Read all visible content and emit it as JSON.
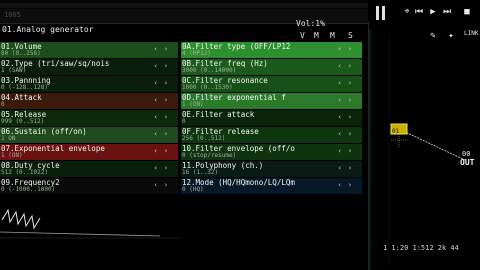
{
  "topbar": {
    "label_left": "1065",
    "volume": "Vol:1%"
  },
  "toolbar": {
    "icons": [
      "pause-bars-icon",
      "pin-icon",
      "skip-back-icon",
      "play-icon",
      "play-next-icon",
      "stop-icon",
      "wrench-icon",
      "wand-icon",
      "link-icon"
    ],
    "link_label": "LINK"
  },
  "panel": {
    "title": "01.Analog generator",
    "buttons": [
      "V",
      "M",
      "M",
      "S"
    ],
    "left": [
      {
        "name": "01.Volume",
        "value": "80 (0..256)",
        "color": "#1a4d1a"
      },
      {
        "name": "02.Type (tri/saw/sq/nois",
        "value": "1 (SAW)",
        "color": "#0a1f0a"
      },
      {
        "name": "03.Pannning",
        "value": "0 (-128..128)",
        "color": "#0a1f0a"
      },
      {
        "name": "04.Attack",
        "value": "0",
        "color": "#3a1a0a"
      },
      {
        "name": "05.Release",
        "value": "999 (0..512)",
        "color": "#0a2a0a"
      },
      {
        "name": "06.Sustain (off/on)",
        "value": "1 ON",
        "color": "#1e4a1e"
      },
      {
        "name": "07.Exponential envelope",
        "value": "1 (ON)",
        "color": "#6a1212"
      },
      {
        "name": "08.Duty cycle",
        "value": "512 (0..1022)",
        "color": "#0a1f0a"
      },
      {
        "name": "09.Frequency2",
        "value": "0 (-1000..1000)",
        "color": "#0a0a0a"
      }
    ],
    "right": [
      {
        "name": "0A.Filter type (OFF/LP12",
        "value": "4 (HP12)",
        "color": "#2e8f2e"
      },
      {
        "name": "0B.Filter freq (Hz)",
        "value": "3000 (0..14000)",
        "color": "#1a5a1a"
      },
      {
        "name": "0C.Filter resonance",
        "value": "1000 (0..1530)",
        "color": "#165016"
      },
      {
        "name": "0D.Filter exponential f",
        "value": "1 (ON)",
        "color": "#2a7a2a"
      },
      {
        "name": "0E.Filter attack",
        "value": "0",
        "color": "#0a240a"
      },
      {
        "name": "0F.Filter release",
        "value": "256 (0..512)",
        "color": "#0e360e"
      },
      {
        "name": "10.Filter envelope (off/o",
        "value": "0 (stop/resume)",
        "color": "#0e330e"
      },
      {
        "name": "11.Polyphony (ch.)",
        "value": "16 (1..32)",
        "color": "#0a1a14"
      },
      {
        "name": "12.Mode (HQ/HQmono/LQ/LQm",
        "value": "0 (HQ)",
        "color": "#061828"
      }
    ]
  },
  "graph": {
    "nodes": [
      {
        "label": "01"
      },
      {
        "label": "00"
      },
      {
        "label": "OUT"
      }
    ]
  },
  "status": {
    "text": "1  1:20  1:512  2k  44"
  }
}
